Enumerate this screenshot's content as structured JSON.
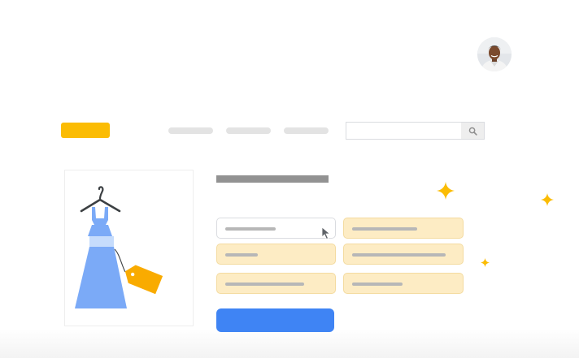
{
  "colors": {
    "brand": "#fbbc04",
    "accent": "#4285f4",
    "field_fill": "#fdecc4",
    "sparkle": "#fbbc04",
    "dress": "#7baaf7"
  },
  "header": {
    "logo_icon": "brand-logo",
    "nav_links": [
      "",
      "",
      ""
    ],
    "search": {
      "placeholder": "",
      "icon": "search-icon"
    }
  },
  "account": {
    "avatar_icon": "user-avatar"
  },
  "product": {
    "image_icon": "dress-on-hanger-with-price-tag",
    "title": ""
  },
  "form": {
    "fields": [
      "",
      "",
      "",
      "",
      "",
      ""
    ],
    "selected_field_index": 0,
    "submit_label": ""
  },
  "decorations": [
    "sparkle-icon",
    "sparkle-icon",
    "sparkle-icon"
  ],
  "cursor": "pointer-cursor-icon"
}
